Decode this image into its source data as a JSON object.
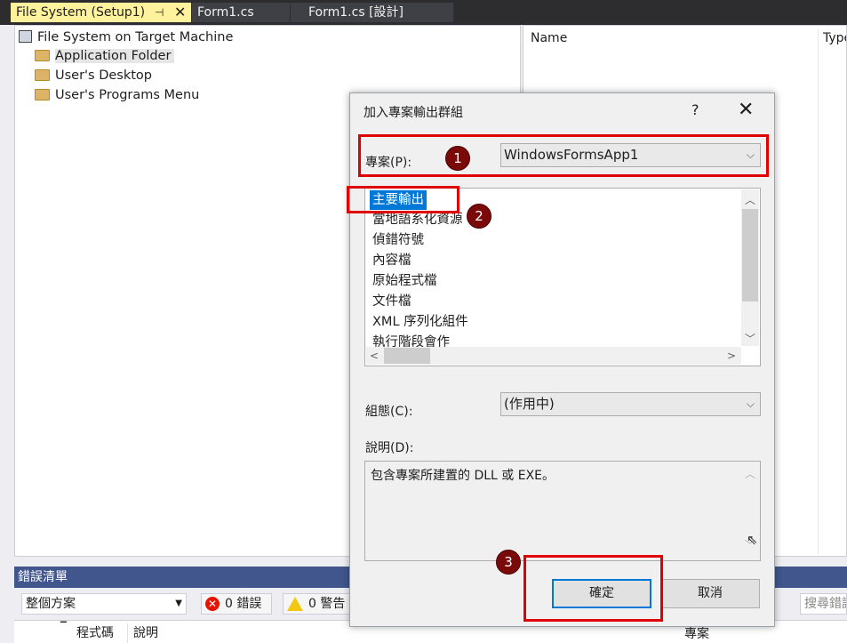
{
  "tabs": {
    "active": "File System (Setup1)",
    "active_pin": "⊣",
    "active_close": "✕",
    "form1": "Form1.cs",
    "form1_design": "Form1.cs [設計]"
  },
  "file_system": {
    "root": "File System on Target Machine",
    "items": [
      "Application Folder",
      "User's Desktop",
      "User's Programs Menu"
    ],
    "selected_index": 0
  },
  "details": {
    "col_name": "Name",
    "col_type": "Type"
  },
  "error_list": {
    "title": "錯誤清單",
    "scope": "整個方案",
    "errors_label": "0 錯誤",
    "warnings_label": "0 警告",
    "search_placeholder": "搜尋錯誤",
    "col_code": "程式碼",
    "col_desc": "說明",
    "col_project": "專案"
  },
  "dialog": {
    "title": "加入專案輸出群組",
    "help": "?",
    "close": "✕",
    "project_label": "專案(P):",
    "project_value": "WindowsFormsApp1",
    "outputs": [
      "主要輸出",
      "當地語系化資源",
      "偵錯符號",
      "內容檔",
      "原始程式檔",
      "文件檔",
      "XML 序列化組件",
      "執行階段會作"
    ],
    "selected_output_index": 0,
    "config_label": "組態(C):",
    "config_value": "(作用中)",
    "desc_label": "說明(D):",
    "desc_text": "包含專案所建置的 DLL 或 EXE。",
    "ok": "確定",
    "cancel": "取消"
  },
  "annotations": {
    "markers": [
      "1",
      "2",
      "3"
    ],
    "color": "#e00000"
  }
}
